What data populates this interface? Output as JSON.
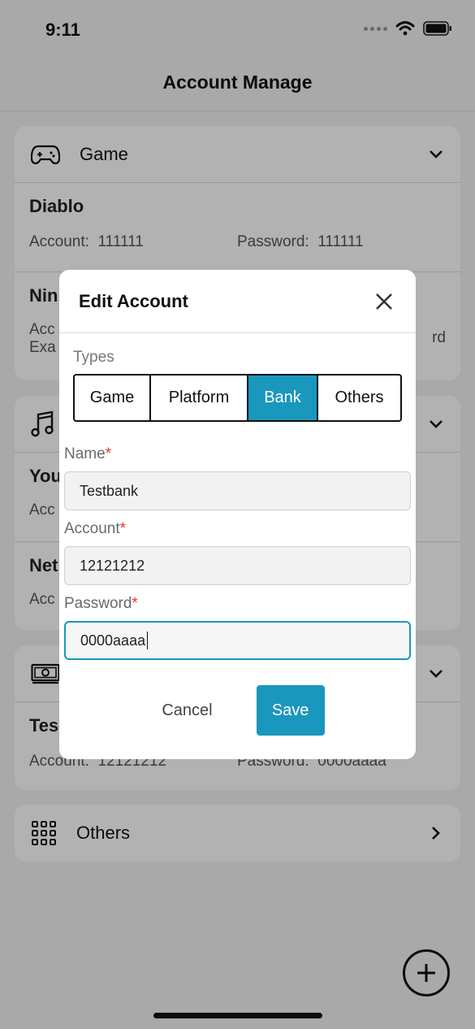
{
  "status_bar": {
    "time": "9:11"
  },
  "nav": {
    "title": "Account Manage"
  },
  "categories": [
    {
      "label": "Game",
      "icon": "gamepad-icon",
      "entries": [
        {
          "name": "Diablo",
          "account_label": "Account:",
          "account": "111111",
          "password_label": "Password:",
          "password": "111111"
        },
        {
          "name_partial": "Nin",
          "line1": "Acc",
          "line2": "Exa",
          "right_fragment": "rd"
        }
      ]
    },
    {
      "label": "",
      "icon": "music-note-icon",
      "entries": [
        {
          "name_partial": "You",
          "line1": "Acc"
        },
        {
          "name_partial": "Net",
          "line1": "Acc"
        }
      ]
    },
    {
      "label": "",
      "icon": "money-icon",
      "entries": [
        {
          "name_partial": "Tes",
          "account_label": "Account:",
          "account": "12121212",
          "password_label": "Password:",
          "password": "0000aaaa"
        }
      ]
    },
    {
      "label": "Others",
      "icon": "grid-icon"
    }
  ],
  "modal": {
    "title": "Edit Account",
    "types_label": "Types",
    "types": [
      "Game",
      "Platform",
      "Bank",
      "Others"
    ],
    "selected_type": "Bank",
    "fields": [
      {
        "label": "Name",
        "required_mark": "*",
        "value": "Testbank"
      },
      {
        "label": "Account",
        "required_mark": "*",
        "value": "12121212"
      },
      {
        "label": "Password",
        "required_mark": "*",
        "value": "0000aaaa"
      }
    ],
    "cancel_label": "Cancel",
    "save_label": "Save"
  },
  "colors": {
    "accent": "#1a97bd",
    "required": "#e33333",
    "overlay": "rgba(0,0,0,0.30)"
  }
}
